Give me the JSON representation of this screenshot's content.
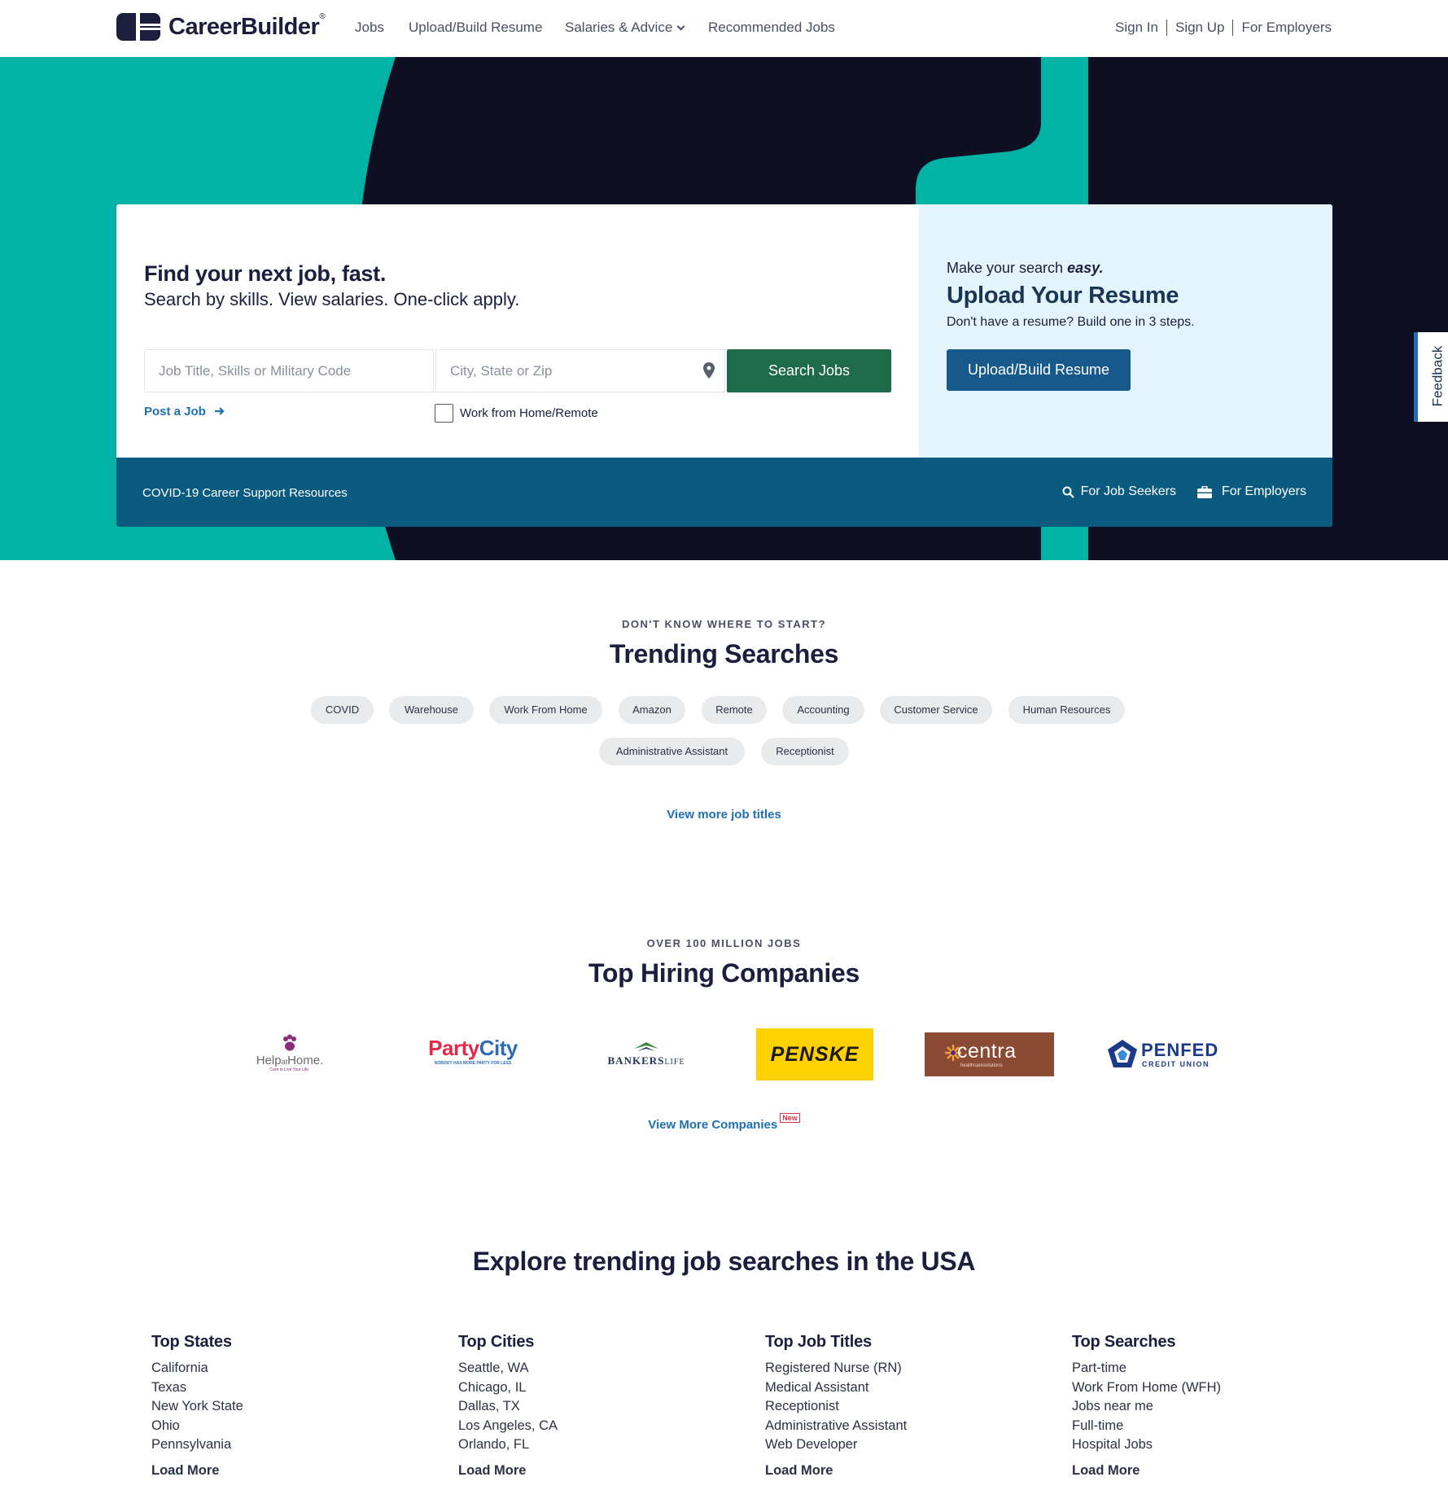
{
  "nav": {
    "brand": "CareerBuilder",
    "brand_mark": "®",
    "links": [
      "Jobs",
      "Upload/Build Resume",
      "Salaries & Advice",
      "Recommended Jobs"
    ],
    "right_links": [
      "Sign In",
      "Sign Up",
      "For Employers"
    ]
  },
  "hero": {
    "headline": "Find your next job, fast.",
    "subheadline": "Search by skills. View salaries. One-click apply.",
    "search": {
      "keyword_placeholder": "Job Title, Skills or Military Code",
      "location_placeholder": "City, State or Zip",
      "button_label": "Search Jobs"
    },
    "post_job_label": "Post a Job",
    "remote_checkbox_label": "Work from Home/Remote",
    "resume": {
      "tagline_prefix": "Make your search ",
      "tagline_emphasis": "easy.",
      "title": "Upload Your Resume",
      "subtitle": "Don't have a resume? Build one in 3 steps.",
      "button_label": "Upload/Build Resume"
    },
    "footer_bar": {
      "covid_link": "COVID-19 Career Support Resources",
      "job_seekers_link": "For Job Seekers",
      "employers_link": "For Employers"
    }
  },
  "feedback_label": "Feedback",
  "trending": {
    "eyebrow": "DON'T KNOW WHERE TO START?",
    "title": "Trending Searches",
    "pills": [
      "COVID",
      "Warehouse",
      "Work From Home",
      "Amazon",
      "Remote",
      "Accounting",
      "Customer Service",
      "Human Resources",
      "Administrative Assistant",
      "Receptionist"
    ],
    "more_link": "View more job titles"
  },
  "companies": {
    "eyebrow": "OVER 100 MILLION JOBS",
    "title": "Top Hiring Companies",
    "logos": {
      "help_at_home": {
        "name": "Help at Home.",
        "main": "Help",
        "at": "at",
        "home": "Home.",
        "tagline": "Care to Live Your Life."
      },
      "party_city": {
        "name": "Party City",
        "p1": "Party",
        "p2": "City",
        "tagline": "NOBODY HAS MORE PARTY FOR LESS"
      },
      "bankers_life": {
        "name": "BANKERS LIFE",
        "b": "BANKERS",
        "l": "LIFE"
      },
      "penske": {
        "name": "PENSKE"
      },
      "centra": {
        "name": "centra",
        "tagline": "healthcaresolutions"
      },
      "penfed": {
        "name": "PENFED",
        "sub": "CREDIT UNION"
      }
    },
    "more_link": "View More Companies",
    "new_badge": "New"
  },
  "explore": {
    "title": "Explore trending job searches in the USA",
    "columns": [
      {
        "title": "Top States",
        "items": [
          "California",
          "Texas",
          "New York State",
          "Ohio",
          "Pennsylvania"
        ],
        "more": "Load More"
      },
      {
        "title": "Top Cities",
        "items": [
          "Seattle, WA",
          "Chicago, IL",
          "Dallas, TX",
          "Los Angeles, CA",
          "Orlando, FL"
        ],
        "more": "Load More"
      },
      {
        "title": "Top Job Titles",
        "items": [
          "Registered Nurse (RN)",
          "Medical Assistant",
          "Receptionist",
          "Administrative Assistant",
          "Web Developer"
        ],
        "more": "Load More"
      },
      {
        "title": "Top Searches",
        "items": [
          "Part-time",
          "Work From Home (WFH)",
          "Jobs near me",
          "Full-time",
          "Hospital Jobs"
        ],
        "more": "Load More"
      }
    ]
  },
  "colors": {
    "teal": "#00b3a4",
    "navy": "#0f0f24",
    "search_green": "#1f6a4a",
    "upload_blue": "#16598a",
    "bar_blue": "#0b5a7f",
    "link_blue": "#1f6fb5",
    "penske_yellow": "#ffd100"
  }
}
